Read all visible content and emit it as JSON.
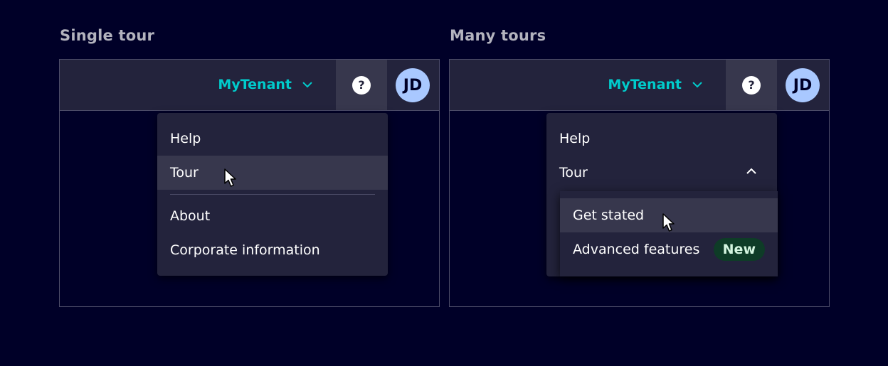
{
  "panels": [
    {
      "title": "Single tour",
      "tenant": "MyTenant",
      "help_glyph": "?",
      "avatar": "JD",
      "menu": [
        "Help",
        "Tour",
        "About",
        "Corporate information"
      ]
    },
    {
      "title": "Many tours",
      "tenant": "MyTenant",
      "help_glyph": "?",
      "avatar": "JD",
      "menu": [
        "Help",
        "Tour"
      ],
      "submenu": [
        "Get stated",
        "Advanced features"
      ],
      "badge": "New"
    }
  ],
  "colors": {
    "background": "#000028",
    "bar": "#23233c",
    "accent": "#00cccc",
    "hover": "#37374d",
    "avatar": "#a9c8ff",
    "badge": "#0e3c27"
  }
}
